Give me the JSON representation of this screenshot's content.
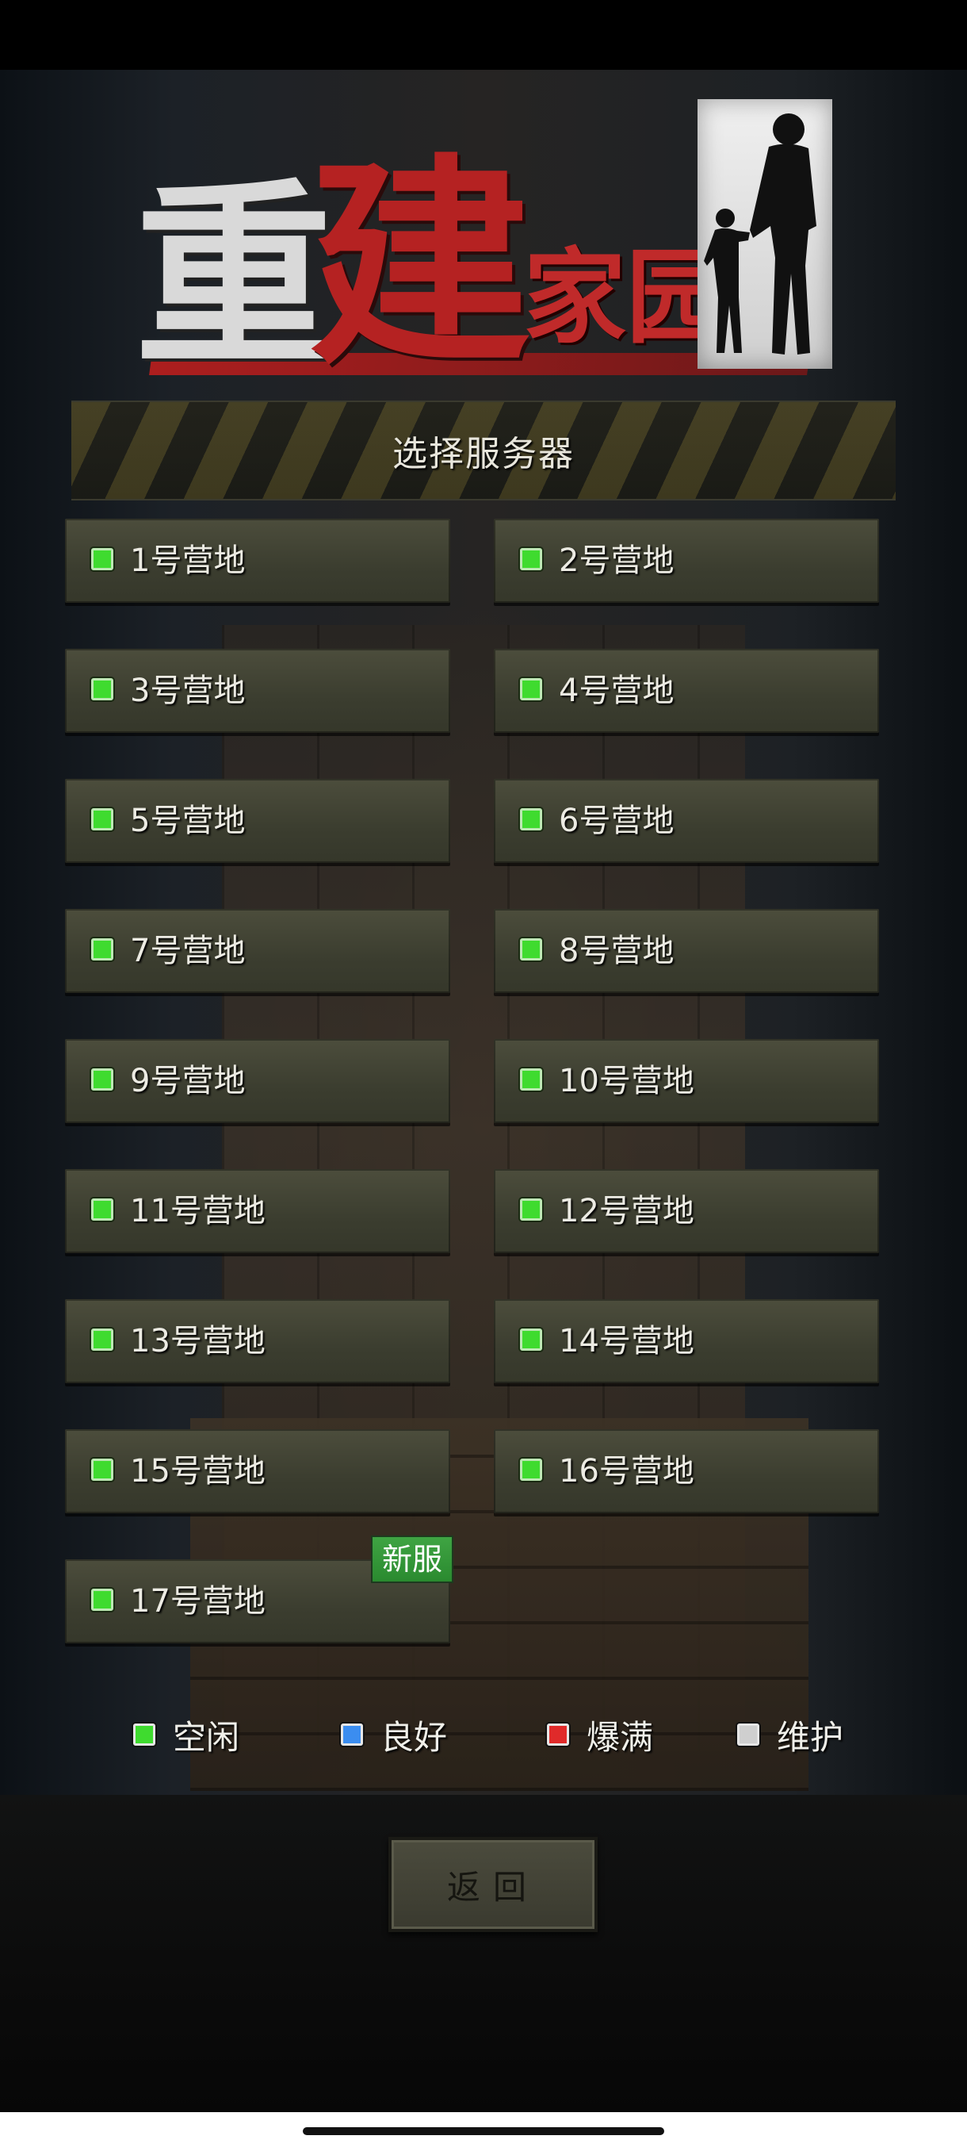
{
  "logo": {
    "char1": "重",
    "char2": "建",
    "chars_small": "家园"
  },
  "header": {
    "title": "选择服务器"
  },
  "servers": [
    {
      "label": "1号营地",
      "status": "空闲"
    },
    {
      "label": "2号营地",
      "status": "空闲"
    },
    {
      "label": "3号营地",
      "status": "空闲"
    },
    {
      "label": "4号营地",
      "status": "空闲"
    },
    {
      "label": "5号营地",
      "status": "空闲"
    },
    {
      "label": "6号营地",
      "status": "空闲"
    },
    {
      "label": "7号营地",
      "status": "空闲"
    },
    {
      "label": "8号营地",
      "status": "空闲"
    },
    {
      "label": "9号营地",
      "status": "空闲"
    },
    {
      "label": "10号营地",
      "status": "空闲"
    },
    {
      "label": "11号营地",
      "status": "空闲"
    },
    {
      "label": "12号营地",
      "status": "空闲"
    },
    {
      "label": "13号营地",
      "status": "空闲"
    },
    {
      "label": "14号营地",
      "status": "空闲"
    },
    {
      "label": "15号营地",
      "status": "空闲"
    },
    {
      "label": "16号营地",
      "status": "空闲"
    },
    {
      "label": "17号营地",
      "status": "空闲",
      "badge": "新服"
    }
  ],
  "legend": [
    {
      "label": "空闲",
      "color": "#3fdb2f"
    },
    {
      "label": "良好",
      "color": "#3b8df0"
    },
    {
      "label": "爆满",
      "color": "#e02a2a"
    },
    {
      "label": "维护",
      "color": "#cfcfcf"
    }
  ],
  "back_button": {
    "label": "返回"
  }
}
